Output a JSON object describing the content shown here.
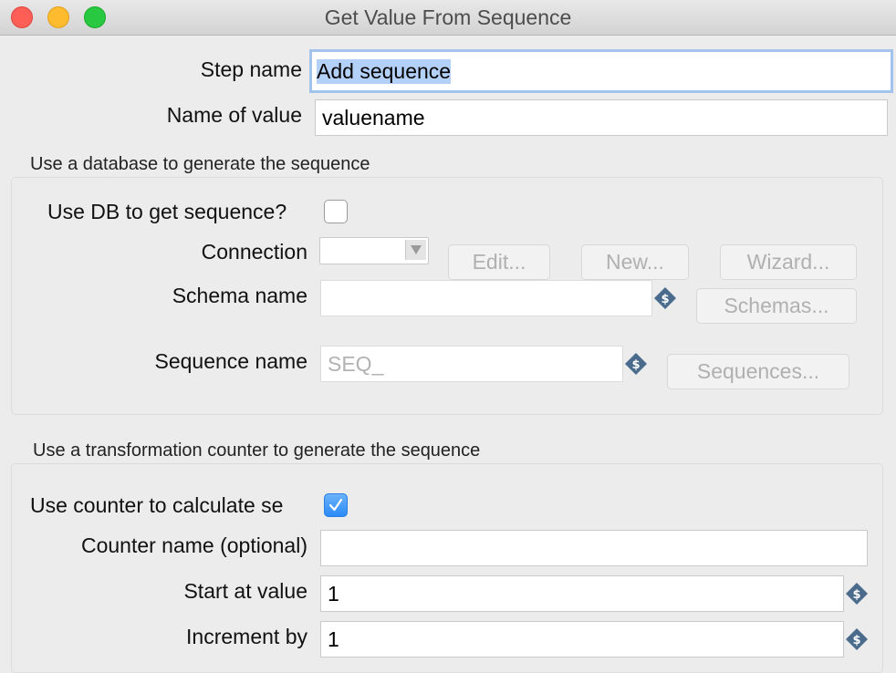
{
  "window": {
    "title": "Get Value From Sequence"
  },
  "step_name": {
    "label": "Step name",
    "value": "Add sequence"
  },
  "name_of_value": {
    "label": "Name of value",
    "value": "valuename"
  },
  "db_section": {
    "title": "Use a database to generate the sequence",
    "use_db_label": "Use DB to get sequence?",
    "use_db_checked": false,
    "connection_label": "Connection",
    "connection_value": "",
    "edit_label": "Edit...",
    "new_label": "New...",
    "wizard_label": "Wizard...",
    "schema_label": "Schema name",
    "schema_value": "",
    "schemas_button": "Schemas...",
    "sequence_label": "Sequence name",
    "sequence_value": "SEQ_",
    "sequences_button": "Sequences..."
  },
  "counter_section": {
    "title": "Use a transformation counter to generate the sequence",
    "use_counter_label": "Use counter to calculate se",
    "use_counter_checked": true,
    "counter_name_label": "Counter name (optional)",
    "counter_name_value": "",
    "start_label": "Start at value",
    "start_value": "1",
    "increment_label": "Increment by",
    "increment_value": "1"
  },
  "colors": {
    "accent": "#2a8af6",
    "focus_ring": "#a3c2ec",
    "variable_icon": "#4a6b8c"
  },
  "icons": {
    "variable": "dollar-diamond-icon"
  }
}
